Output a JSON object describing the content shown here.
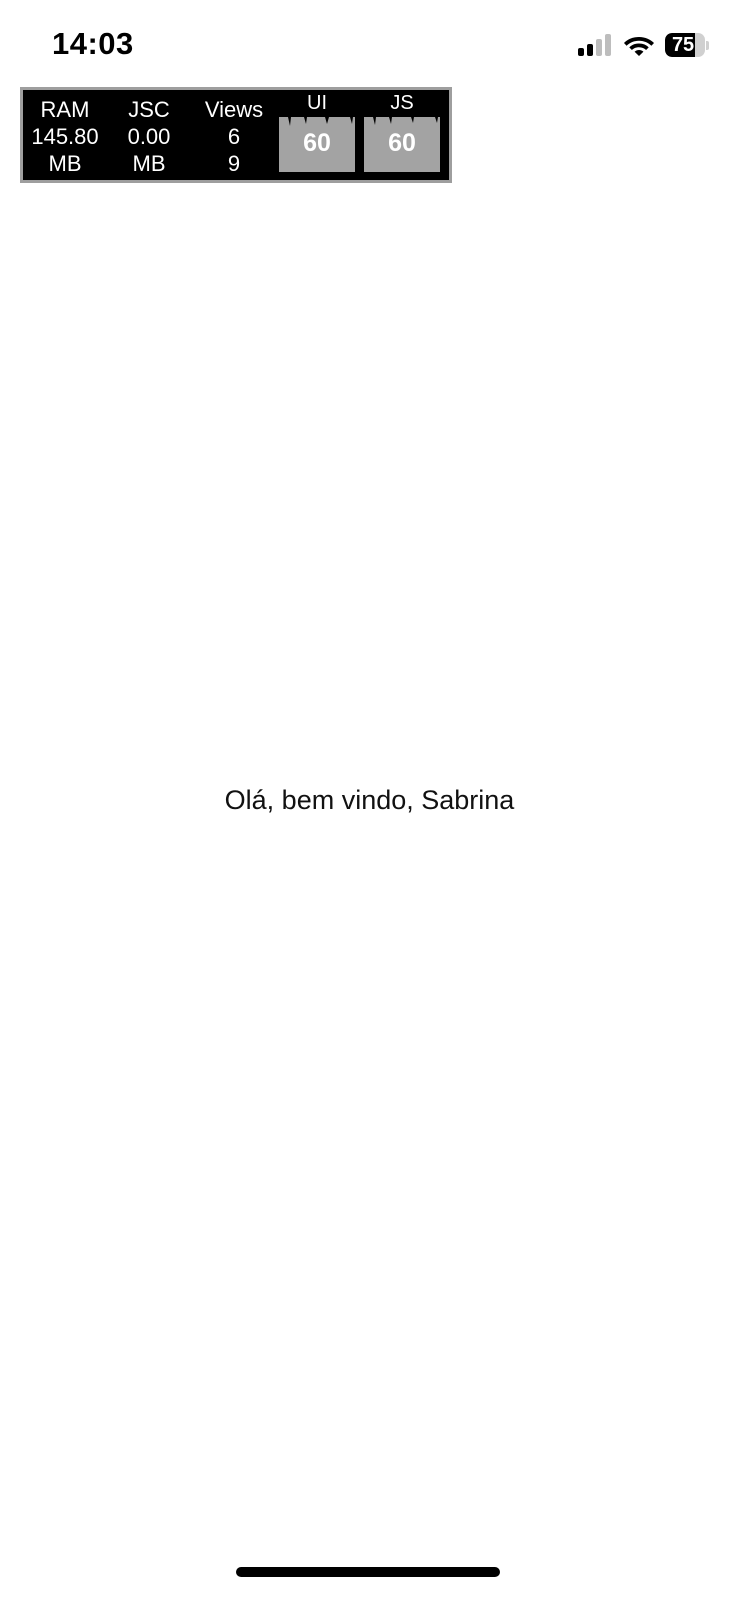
{
  "status_bar": {
    "time": "14:03",
    "battery_level": "75",
    "battery_percent": 75,
    "signal_bars_active": 2,
    "signal_bars_total": 4
  },
  "perf_monitor": {
    "ram": {
      "label": "RAM",
      "value": "145.80",
      "unit": "MB"
    },
    "jsc": {
      "label": "JSC",
      "value": "0.00",
      "unit": "MB"
    },
    "views": {
      "label": "Views",
      "visible": "6",
      "total": "9"
    },
    "ui_fps": {
      "label": "UI",
      "value": "60"
    },
    "js_fps": {
      "label": "JS",
      "value": "60"
    },
    "colors": {
      "background": "#000000",
      "border": "#9e9e9e",
      "fps_box": "#a3a3a3"
    }
  },
  "main": {
    "welcome_text": "Olá, bem vindo, Sabrina"
  },
  "icons": {
    "signal": "cellular-signal-icon",
    "wifi": "wifi-icon",
    "battery": "battery-icon"
  }
}
